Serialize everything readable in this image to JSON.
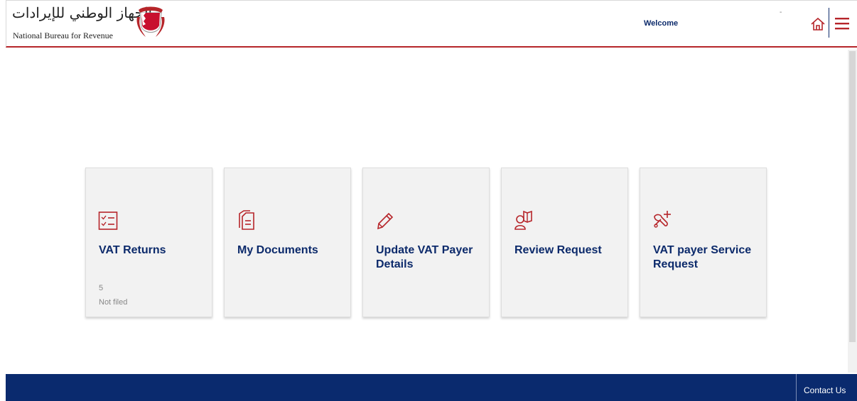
{
  "header": {
    "logo_arabic": "الجهاز الوطني للإيرادات",
    "logo_english": "National Bureau for Revenue",
    "welcome": "Welcome",
    "dash": "-"
  },
  "tiles": [
    {
      "label": "VAT Returns",
      "count": "5",
      "status": "Not filed",
      "icon": "checklist-icon"
    },
    {
      "label": "My Documents",
      "icon": "documents-icon"
    },
    {
      "label": "Update VAT Payer Details",
      "icon": "pencil-icon"
    },
    {
      "label": "Review Request",
      "icon": "user-book-icon"
    },
    {
      "label": "VAT payer Service Request",
      "icon": "tools-plus-icon"
    }
  ],
  "footer": {
    "contact": "Contact Us"
  },
  "colors": {
    "brand_red": "#b6252a",
    "navy": "#0c2a6b",
    "footer_bg": "#0a2a6e",
    "tile_bg": "#f2f2f2"
  }
}
